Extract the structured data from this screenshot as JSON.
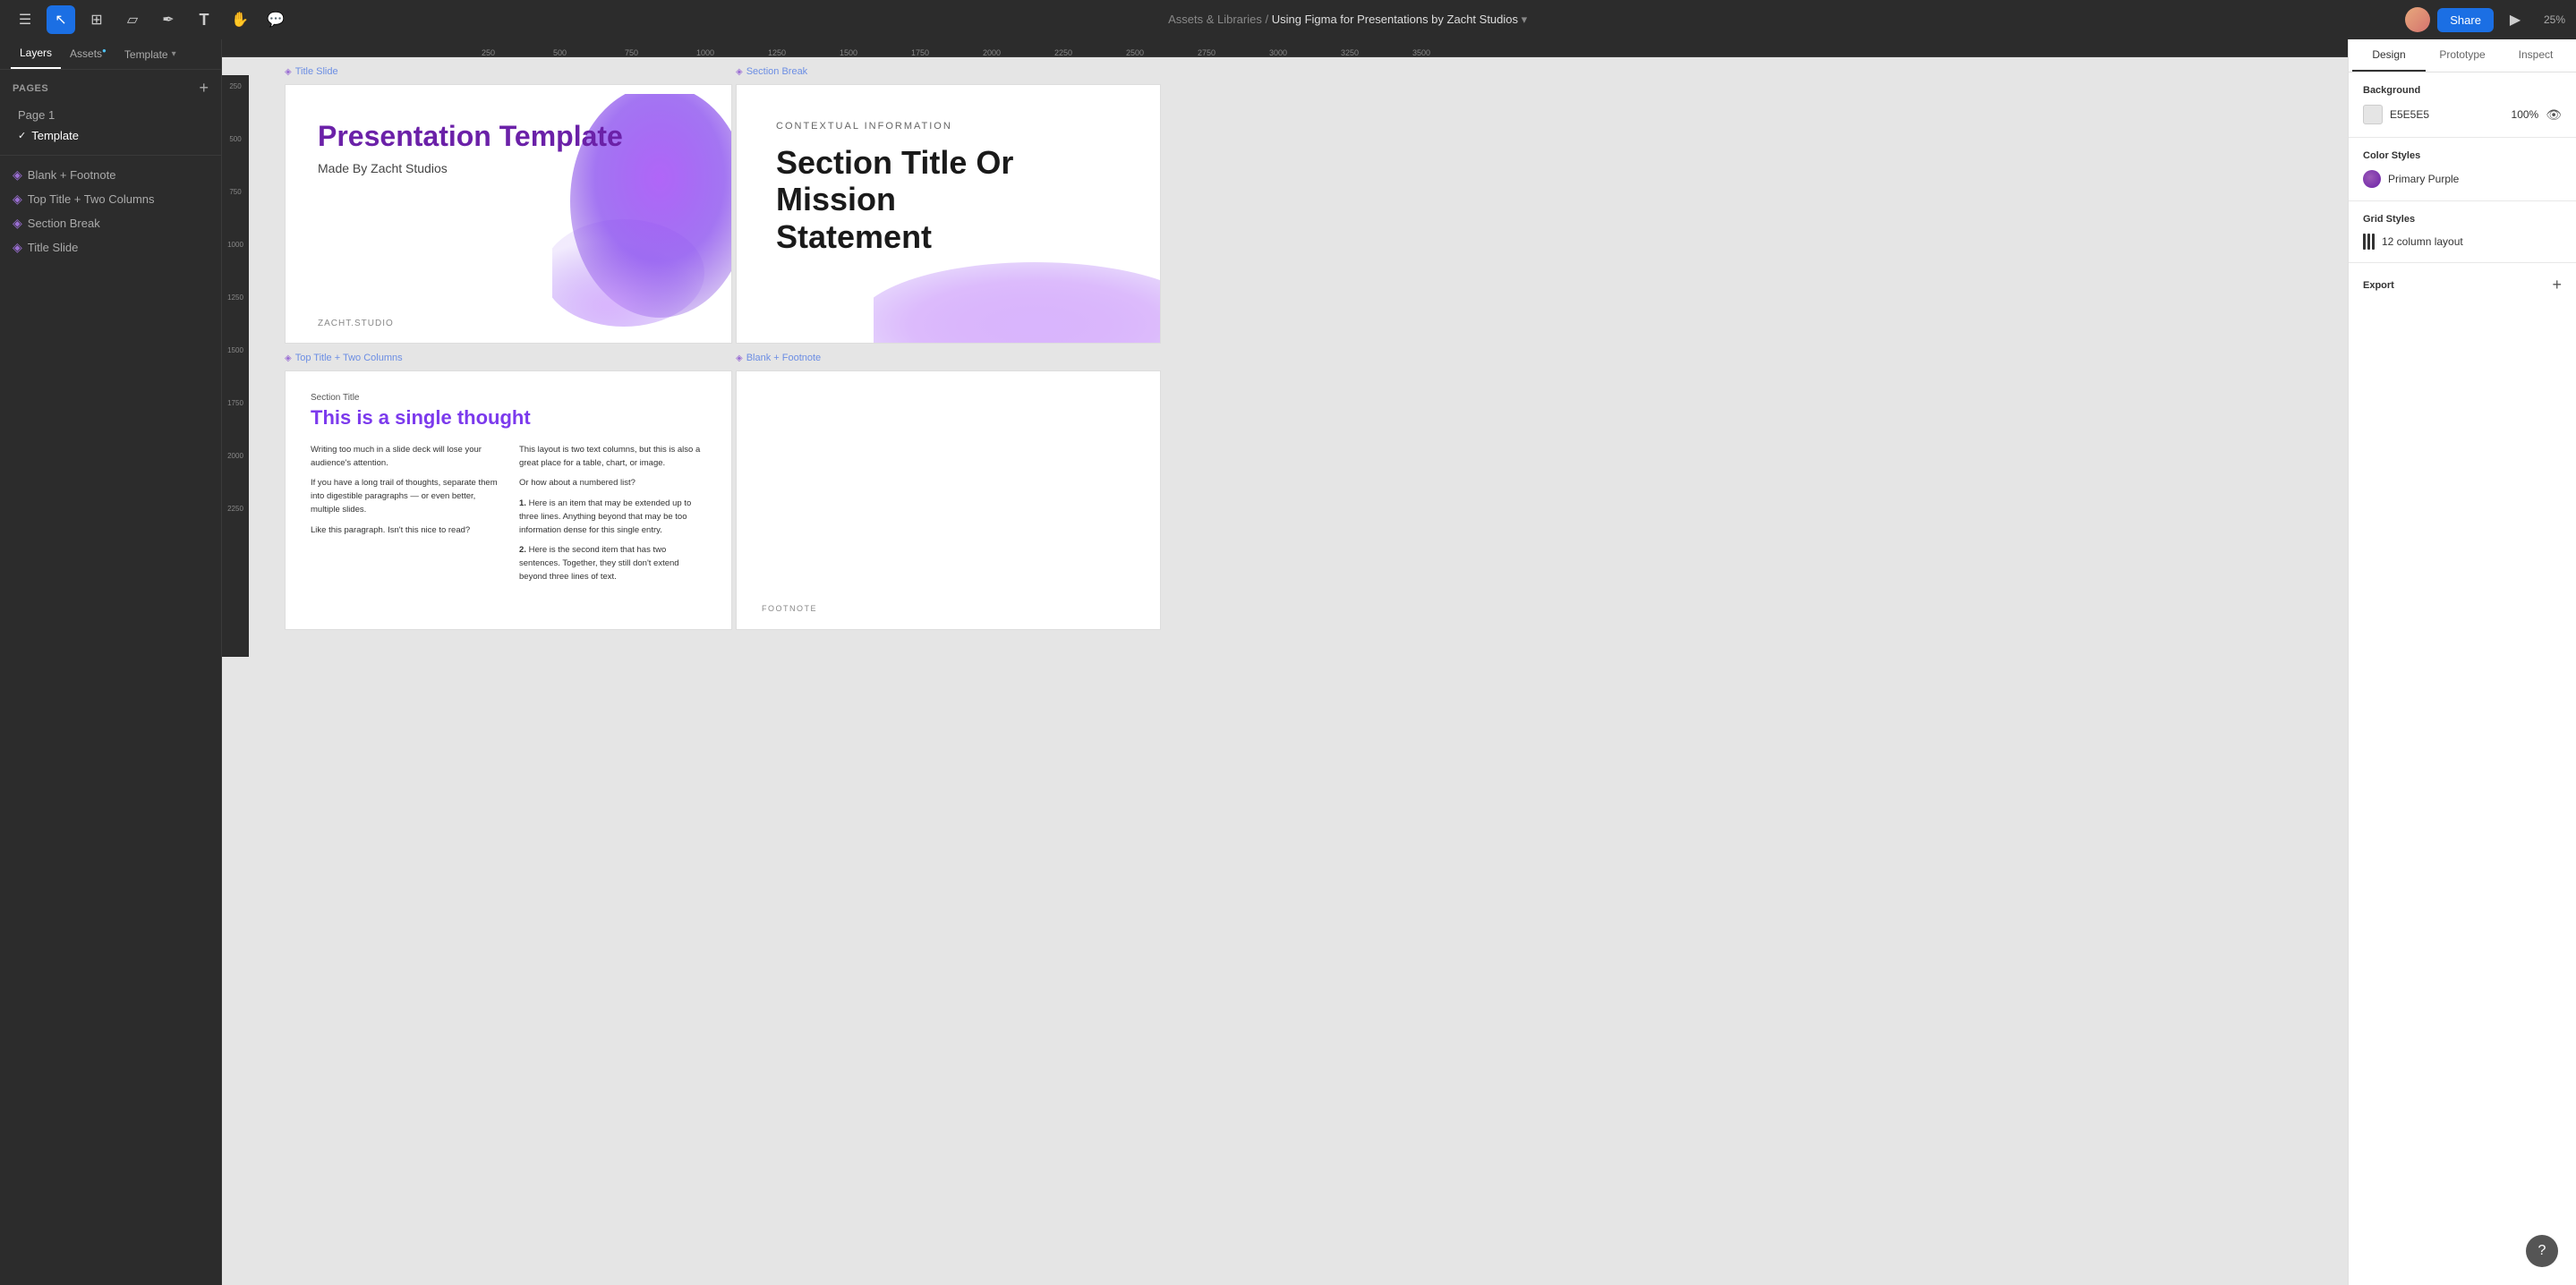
{
  "toolbar": {
    "title_path": "Assets & Libraries",
    "separator": "/",
    "title_main": "Using Figma for Presentations by Zacht Studios",
    "share_label": "Share",
    "zoom_level": "25%",
    "tools": [
      "select",
      "frame",
      "shape",
      "pen",
      "text",
      "hand",
      "comment"
    ]
  },
  "left_sidebar": {
    "tabs": [
      {
        "id": "layers",
        "label": "Layers"
      },
      {
        "id": "assets",
        "label": "Assets"
      },
      {
        "id": "template",
        "label": "Template"
      }
    ],
    "pages_title": "Pages",
    "pages": [
      {
        "id": "page1",
        "label": "Page 1",
        "active": false
      },
      {
        "id": "template",
        "label": "Template",
        "active": true,
        "check": true
      }
    ],
    "layers": [
      {
        "id": "blank-footnote",
        "label": "Blank + Footnote",
        "type": "component"
      },
      {
        "id": "top-title-two-cols",
        "label": "Top Title + Two Columns",
        "type": "component"
      },
      {
        "id": "section-break",
        "label": "Section Break",
        "type": "component"
      },
      {
        "id": "title-slide",
        "label": "Title Slide",
        "type": "component"
      }
    ]
  },
  "canvas": {
    "background_color": "#E5E5E5",
    "frames": {
      "title_slide": {
        "label": "Title Slide",
        "main_title": "Presentation Template",
        "subtitle": "Made By Zacht Studios",
        "footer": "ZACHT.STUDIO"
      },
      "section_break": {
        "label": "Section Break",
        "contextual": "CONTEXTUAL INFORMATION",
        "title_line1": "Section Title Or Mission",
        "title_line2": "Statement"
      },
      "top_title_two_columns": {
        "label": "Top Title + Two Columns",
        "section_label": "Section Title",
        "title": "This is a single thought",
        "col1_p1": "Writing too much in a slide deck will lose your audience's attention.",
        "col1_p2": "If you have a long trail of thoughts, separate them into digestible paragraphs — or even better, multiple slides.",
        "col1_p3": "Like this paragraph. Isn't this nice to read?",
        "col2_p1": "This layout is two text columns, but this is also a great place for a table, chart, or image.",
        "col2_p2": "Or how about a numbered list?",
        "col2_item1": "1.",
        "col2_item1_text": "Here is an item that may be extended up to three lines. Anything beyond that may be too information dense for this single entry.",
        "col2_item2": "2.",
        "col2_item2_text": "Here is the second item that has two sentences. Together, they still don't extend beyond three lines of text."
      },
      "blank_footnote": {
        "label": "Blank + Footnote",
        "footnote": "FOOTNOTE"
      }
    }
  },
  "right_sidebar": {
    "tabs": [
      {
        "id": "design",
        "label": "Design",
        "active": true
      },
      {
        "id": "prototype",
        "label": "Prototype"
      },
      {
        "id": "inspect",
        "label": "Inspect"
      }
    ],
    "background": {
      "section_title": "Background",
      "hex": "E5E5E5",
      "opacity": "100%"
    },
    "color_styles": {
      "section_title": "Color Styles",
      "items": [
        {
          "id": "primary-purple",
          "name": "Primary Purple",
          "color": "#7C3AED"
        }
      ]
    },
    "grid_styles": {
      "section_title": "Grid Styles",
      "items": [
        {
          "id": "12-col",
          "name": "12 column layout"
        }
      ]
    },
    "export": {
      "label": "Export"
    }
  },
  "help": {
    "label": "?"
  }
}
